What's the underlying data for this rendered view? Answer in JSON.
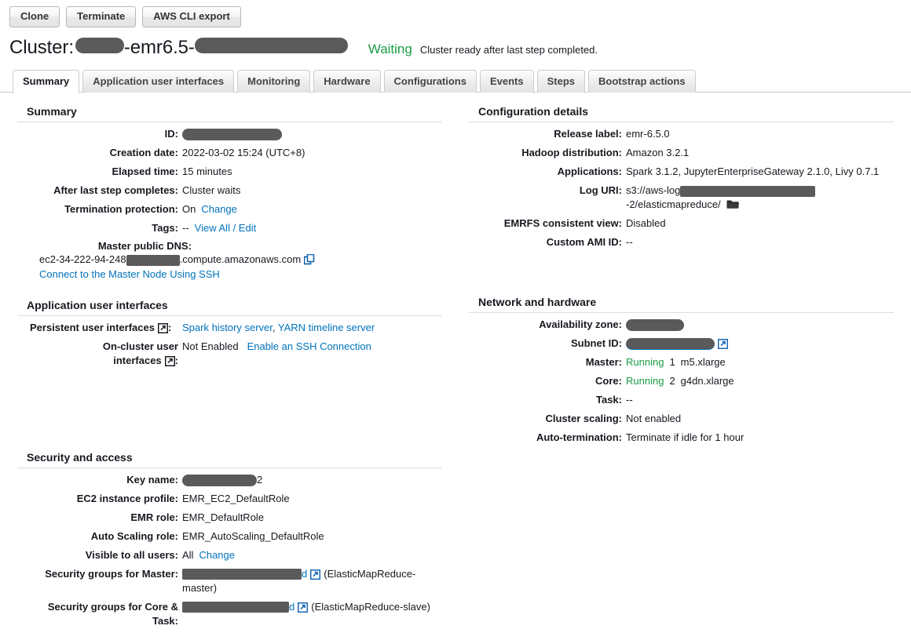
{
  "toolbar": {
    "buttons": [
      {
        "label": "Clone",
        "name": "clone-button"
      },
      {
        "label": "Terminate",
        "name": "terminate-button"
      },
      {
        "label": "AWS CLI export",
        "name": "aws-cli-export-button"
      }
    ]
  },
  "header": {
    "title_prefix": "Cluster:",
    "name_middle": "-emr6.5-",
    "status": "Waiting",
    "status_message": "Cluster ready after last step completed."
  },
  "tabs": [
    {
      "label": "Summary",
      "active": true
    },
    {
      "label": "Application user interfaces",
      "active": false
    },
    {
      "label": "Monitoring",
      "active": false
    },
    {
      "label": "Hardware",
      "active": false
    },
    {
      "label": "Configurations",
      "active": false
    },
    {
      "label": "Events",
      "active": false
    },
    {
      "label": "Steps",
      "active": false
    },
    {
      "label": "Bootstrap actions",
      "active": false
    }
  ],
  "summary": {
    "title": "Summary",
    "id_label": "ID:",
    "creation_date_label": "Creation date:",
    "creation_date_value": "2022-03-02 15:24 (UTC+8)",
    "elapsed_time_label": "Elapsed time:",
    "elapsed_time_value": "15 minutes",
    "after_last_step_label": "After last step completes:",
    "after_last_step_value": "Cluster waits",
    "termination_protection_label": "Termination protection:",
    "termination_protection_value": "On",
    "termination_protection_change": "Change",
    "tags_label": "Tags:",
    "tags_value": "--",
    "tags_link": "View All / Edit",
    "master_dns_label": "Master public DNS:",
    "master_dns_prefix": "ec2-34-222-94-248",
    "master_dns_suffix": ".compute.amazonaws.com",
    "ssh_link": "Connect to the Master Node Using SSH"
  },
  "application_ui": {
    "title": "Application user interfaces",
    "persistent_label": "Persistent user interfaces",
    "persistent_colon": ":",
    "persistent_links": [
      "Spark history server",
      "YARN timeline server"
    ],
    "persistent_separator": ", ",
    "oncluster_label_line1": "On-cluster user",
    "oncluster_label_line2": "interfaces",
    "oncluster_colon": ":",
    "oncluster_value": "Not Enabled",
    "oncluster_link": "Enable an SSH Connection"
  },
  "security": {
    "title": "Security and access",
    "key_name_label": "Key name:",
    "key_name_suffix": "2",
    "ec2_profile_label": "EC2 instance profile:",
    "ec2_profile_value": "EMR_EC2_DefaultRole",
    "emr_role_label": "EMR role:",
    "emr_role_value": "EMR_DefaultRole",
    "autoscaling_role_label": "Auto Scaling role:",
    "autoscaling_role_value": "EMR_AutoScaling_DefaultRole",
    "visible_label": "Visible to all users:",
    "visible_value": "All",
    "visible_change": "Change",
    "sg_master_label": "Security groups for Master:",
    "sg_master_link_suffix": "d",
    "sg_master_note": "(ElasticMapReduce-master)",
    "sg_core_label_line1": "Security groups for Core &",
    "sg_core_label_line2": "Task:",
    "sg_core_link_suffix": "d",
    "sg_core_note": "(ElasticMapReduce-slave)"
  },
  "configuration": {
    "title": "Configuration details",
    "release_label": "Release label:",
    "release_value": "emr-6.5.0",
    "hadoop_label": "Hadoop distribution:",
    "hadoop_value": "Amazon 3.2.1",
    "applications_label": "Applications:",
    "applications_value": "Spark 3.1.2, JupyterEnterpriseGateway 2.1.0, Livy 0.7.1",
    "log_uri_label": "Log URI:",
    "log_uri_prefix": "s3://aws-log",
    "log_uri_suffix": "-2/elasticmapreduce/",
    "emrfs_label": "EMRFS consistent view:",
    "emrfs_value": "Disabled",
    "custom_ami_label": "Custom AMI ID:",
    "custom_ami_value": "--"
  },
  "network": {
    "title": "Network and hardware",
    "az_label": "Availability zone:",
    "subnet_label": "Subnet ID:",
    "master_label": "Master:",
    "master_state": "Running",
    "master_count": "1",
    "master_type": "m5.xlarge",
    "core_label": "Core:",
    "core_state": "Running",
    "core_count": "2",
    "core_type": "g4dn.xlarge",
    "task_label": "Task:",
    "task_value": "--",
    "cluster_scaling_label": "Cluster scaling:",
    "cluster_scaling_value": "Not enabled",
    "auto_termination_label": "Auto-termination:",
    "auto_termination_value": "Terminate if idle for 1 hour"
  },
  "colors": {
    "link": "#0073bb",
    "success": "#1a9c46",
    "text": "#16191f",
    "redaction": "#5a5a5a"
  }
}
